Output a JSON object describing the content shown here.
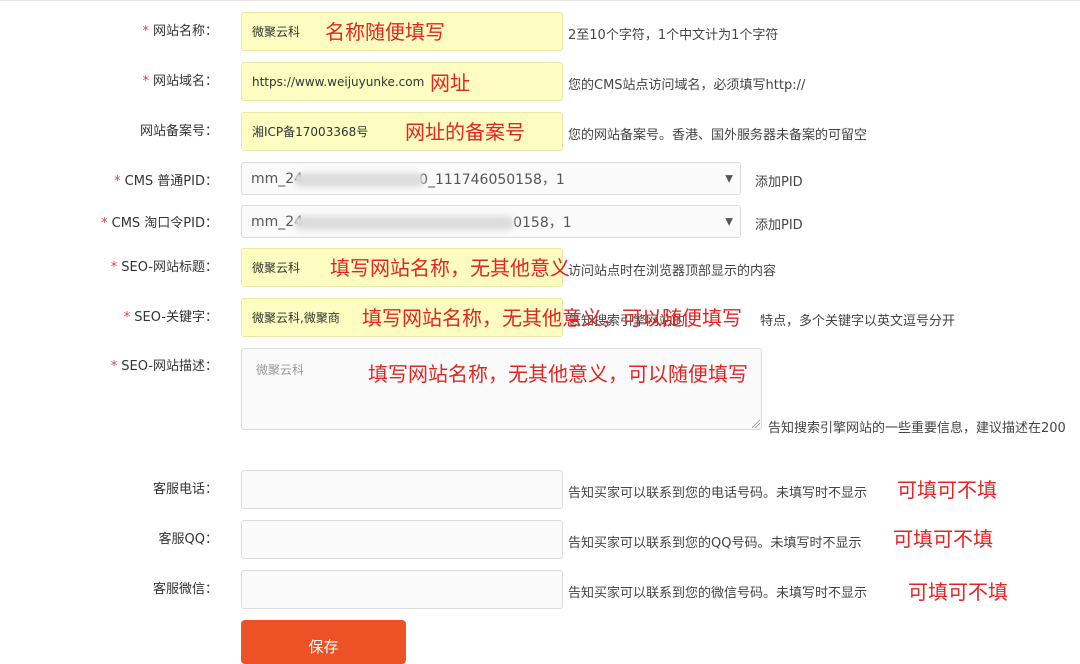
{
  "form": {
    "site_name": {
      "label": "网站名称：",
      "value": "微聚云科",
      "hint": "2至10个字符，1个中文计为1个字符",
      "annotation": "名称随便填写"
    },
    "site_domain": {
      "label": "网站域名：",
      "value": "https://www.weijuyunke.com",
      "hint": "您的CMS站点访问域名，必须填写http://",
      "annotation": "网址"
    },
    "icp": {
      "label": "网站备案号：",
      "value": "湘ICP备17003368号",
      "hint": "您的网站备案号。香港、国外服务器未备案的可留空",
      "annotation": "网址的备案号"
    },
    "cms_pid": {
      "label": "CMS 普通PID：",
      "value_start": "mm_24",
      "value_end": "0_111746050158，1",
      "add": "添加PID"
    },
    "cms_tkl_pid": {
      "label": "CMS 淘口令PID：",
      "value_start": "mm_24",
      "value_end": "0158，1",
      "add": "添加PID"
    },
    "seo_title": {
      "label": "SEO-网站标题：",
      "value": "微聚云科",
      "hint": "访问站点时在浏览器顶部显示的内容",
      "annotation": "填写网站名称，无其他意义"
    },
    "seo_keywords": {
      "label": "SEO-关键字：",
      "value": "微聚云科,微聚商",
      "hint_start": "告知搜索引擎网站的",
      "hint_end": "特点，多个关键字以英文逗号分开",
      "annotation": "填写网站名称，无其他意义，可以随便填写"
    },
    "seo_desc": {
      "label": "SEO-网站描述：",
      "placeholder": "微聚云科",
      "hint": "告知搜索引擎网站的一些重要信息，建议描述在200",
      "annotation": "填写网站名称，无其他意义，可以随便填写"
    },
    "phone": {
      "label": "客服电话：",
      "hint": "告知买家可以联系到您的电话号码。未填写时不显示",
      "annotation": "可填可不填"
    },
    "qq": {
      "label": "客服QQ：",
      "hint": "告知买家可以联系到您的QQ号码。未填写时不显示",
      "annotation": "可填可不填"
    },
    "wechat": {
      "label": "客服微信：",
      "hint": "告知买家可以联系到您的微信号码。未填写时不显示",
      "annotation": "可填可不填"
    },
    "required_mark": "*",
    "save_label": "保存"
  },
  "colors": {
    "required": "#e4393c",
    "annotation": "#e52421",
    "highlight": "#fdfdc2",
    "save_button": "#ec5225"
  }
}
